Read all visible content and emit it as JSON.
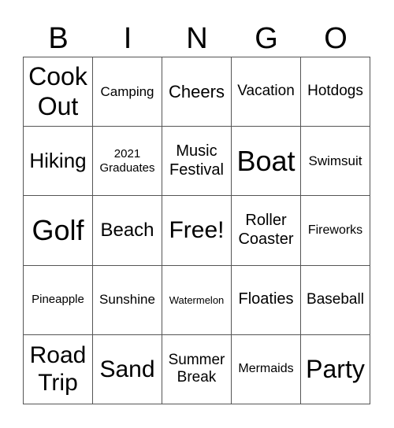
{
  "header": [
    "B",
    "I",
    "N",
    "G",
    "O"
  ],
  "cells": [
    "Cook\nOut",
    "Camping",
    "Cheers",
    "Vacation",
    "Hotdogs",
    "Hiking",
    "2021\nGraduates",
    "Music\nFestival",
    "Boat",
    "Swimsuit",
    "Golf",
    "Beach",
    "Free!",
    "Roller\nCoaster",
    "Fireworks",
    "Pineapple",
    "Sunshine",
    "Watermelon",
    "Floaties",
    "Baseball",
    "Road\nTrip",
    "Sand",
    "Summer\nBreak",
    "Mermaids",
    "Party"
  ]
}
